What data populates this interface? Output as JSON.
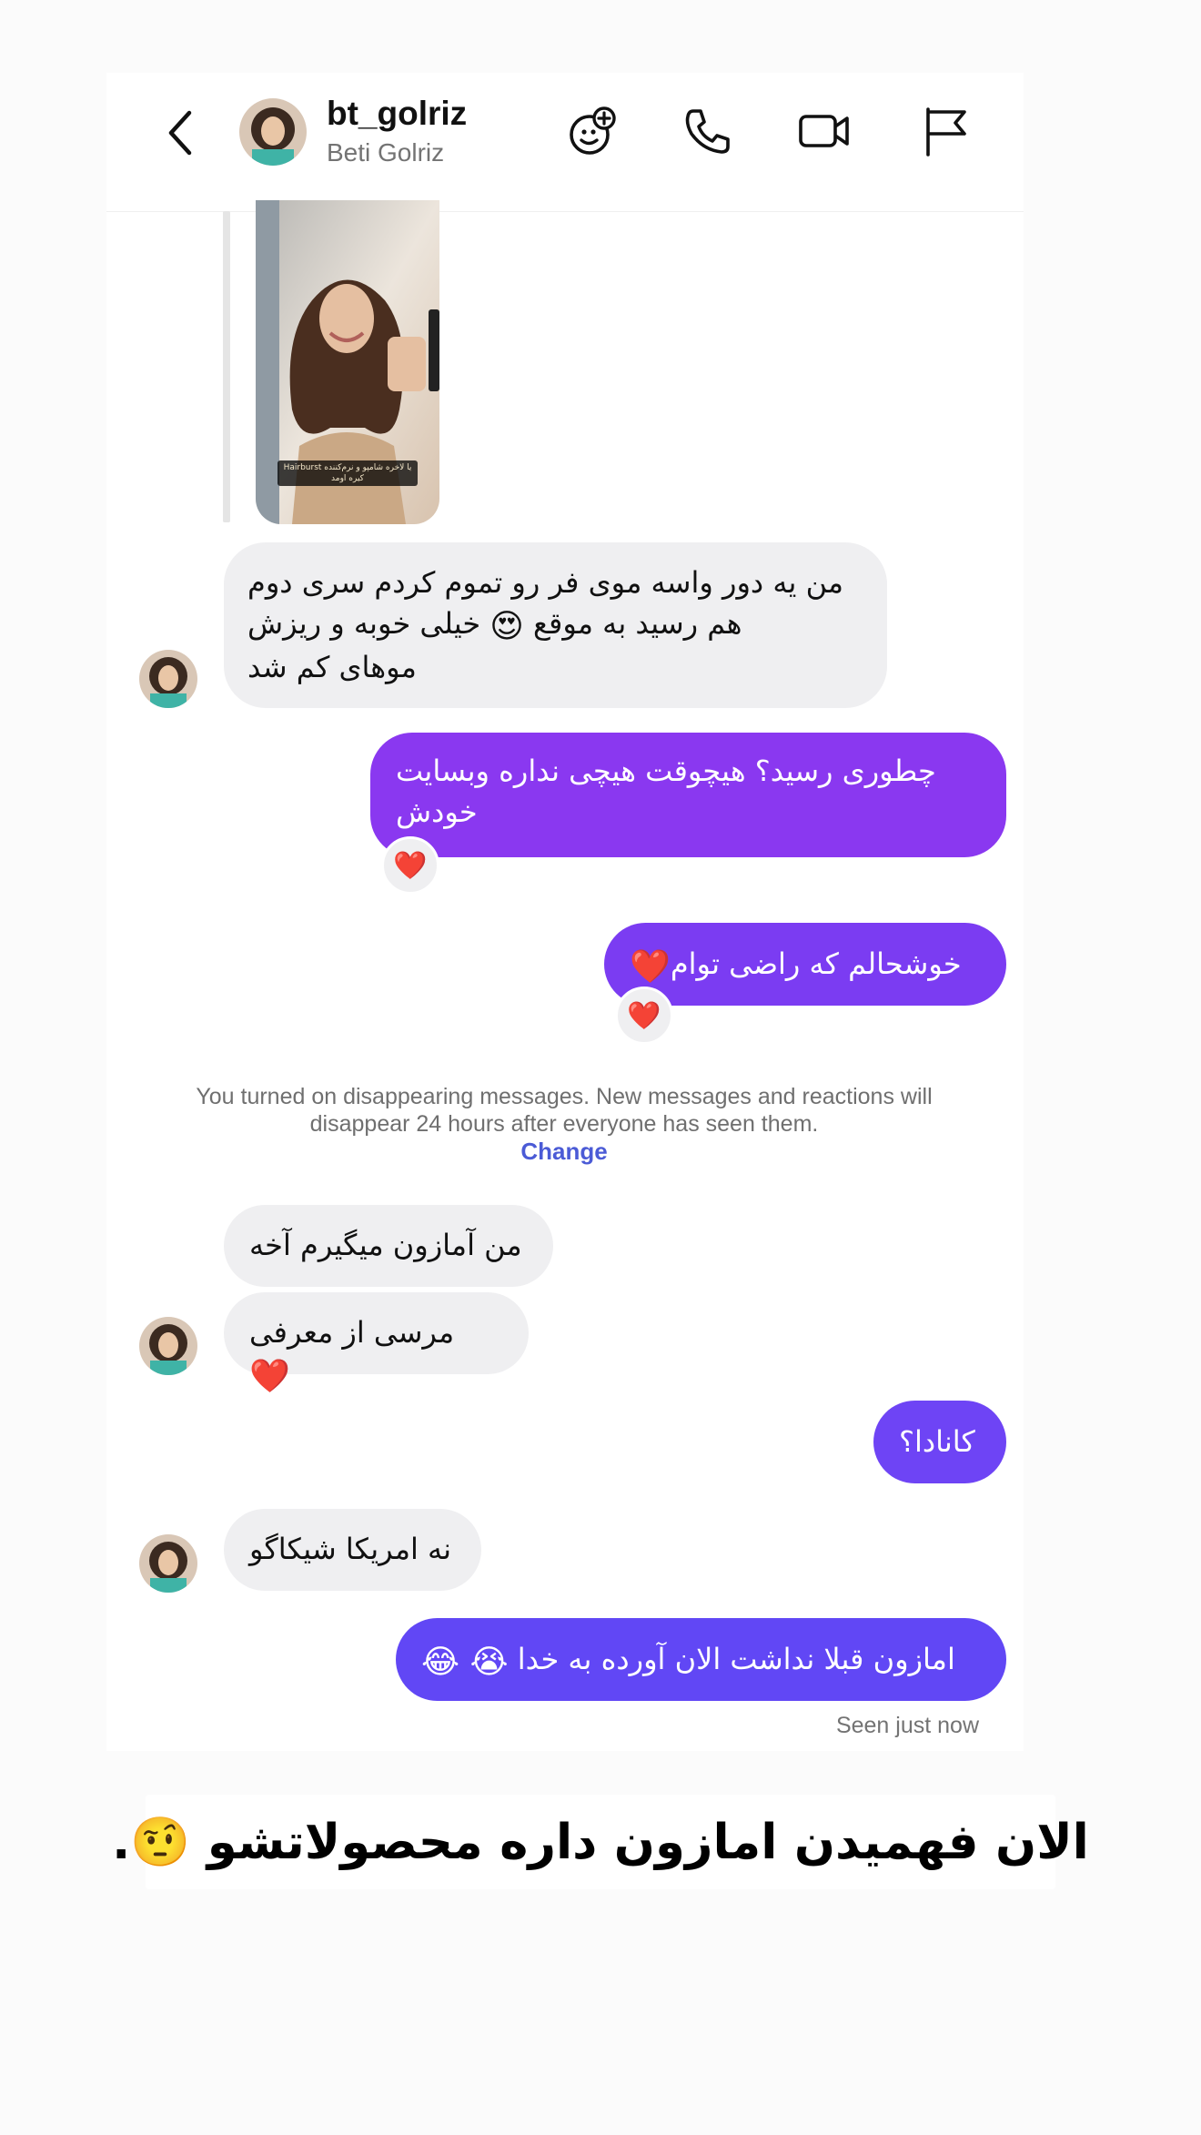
{
  "header": {
    "username": "bt_golriz",
    "full_name": "Beti Golriz",
    "icons": [
      "chevron-left-icon",
      "add-emoji-effects-icon",
      "phone-icon",
      "video-camera-icon",
      "flag-icon"
    ]
  },
  "story": {
    "caption": "یا لاخره شامپو و نرم‌کننده Hairburst کیره اومد"
  },
  "messages": [
    {
      "from": "them",
      "text": "من یه دور واسه موی فر رو تموم کردم سری دوم",
      "line2": "هم رسید به موقع",
      "emoji2": "😍",
      "line2b": "خیلی خوبه و ریزش",
      "line3": "موهای کم شد"
    },
    {
      "from": "me",
      "line1": "چطوری رسید؟ هیچوقت هیچی نداره وبسایت",
      "line2": "خودش",
      "reaction": "❤️"
    },
    {
      "from": "me",
      "text": "خوشحالم که راضی توام",
      "emoji": "❤️",
      "reaction": "❤️"
    },
    {
      "from": "them",
      "text": "من آمازون میگیرم آخه"
    },
    {
      "from": "them",
      "text": "مرسی از معرفی",
      "emoji": "❤️"
    },
    {
      "from": "me",
      "text": "کانادا؟"
    },
    {
      "from": "them",
      "text": "نه امریکا شیکاگو"
    },
    {
      "from": "me",
      "text": "امازون قبلا نداشت الان آورده به خدا",
      "emoji": "😭 😂"
    }
  ],
  "system_notice": {
    "text": "You turned on disappearing messages. New messages and reactions will disappear 24 hours after everyone has seen them.",
    "action": "Change"
  },
  "seen_status": "Seen just now",
  "overlay_caption": {
    "text": "الان فهمیدن امازون داره محصولاتشو",
    "emoji": "🤨",
    "trailing": "."
  },
  "colors": {
    "bubble_incoming": "#efeff1",
    "bubble_outgoing_1": "#8a38f0",
    "bubble_outgoing_2": "#7b3cf2",
    "bubble_outgoing_3": "#6e44f5",
    "bubble_outgoing_4": "#6147f5",
    "link": "#4b5bd6"
  }
}
